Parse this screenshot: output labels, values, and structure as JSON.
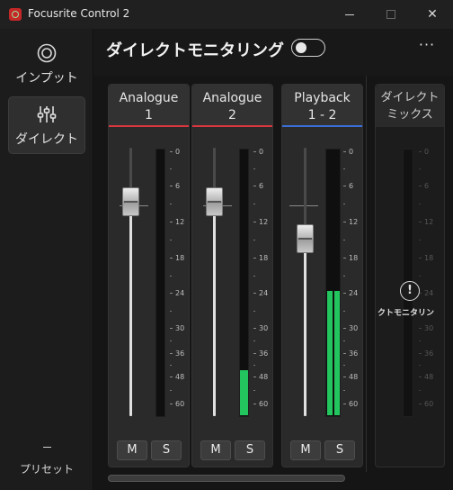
{
  "window": {
    "title": "Focusrite Control 2",
    "close_glyph": "✕"
  },
  "sidebar": {
    "items": [
      {
        "id": "inputs",
        "label": "インプット",
        "icon": "target-icon",
        "active": false
      },
      {
        "id": "direct",
        "label": "ダイレクト",
        "icon": "sliders-icon",
        "active": true
      }
    ],
    "preset": {
      "label": "プリセット"
    }
  },
  "header": {
    "title": "ダイレクトモニタリング",
    "toggle_on": false,
    "more_glyph": "···"
  },
  "colors": {
    "analogue_line": "#d9363e",
    "playback_line": "#3b6fd8",
    "meter_green": "#22c55e"
  },
  "scale_labels": [
    "0",
    "6",
    "12",
    "18",
    "24",
    "30",
    "36",
    "48",
    "60"
  ],
  "channels": [
    {
      "id": "analogue-1",
      "name_line1": "Analogue",
      "name_line2": "1",
      "line_color": "#d9363e",
      "fader_level": 0.8,
      "meter_level": 0.0,
      "mute_label": "M",
      "solo_label": "S"
    },
    {
      "id": "analogue-2",
      "name_line1": "Analogue",
      "name_line2": "2",
      "line_color": "#d9363e",
      "fader_level": 0.8,
      "meter_level": 0.17,
      "mute_label": "M",
      "solo_label": "S"
    },
    {
      "id": "playback-1-2",
      "name_line1": "Playback",
      "name_line2": "1 - 2",
      "line_color": "#3b6fd8",
      "fader_level": 0.66,
      "meter_level": 0.47,
      "mute_label": "M",
      "solo_label": "S"
    }
  ],
  "direct_mix": {
    "title_line1": "ダイレクト",
    "title_line2": "ミックス",
    "warning_glyph": "!",
    "warning_text": "クトモニタリン"
  }
}
